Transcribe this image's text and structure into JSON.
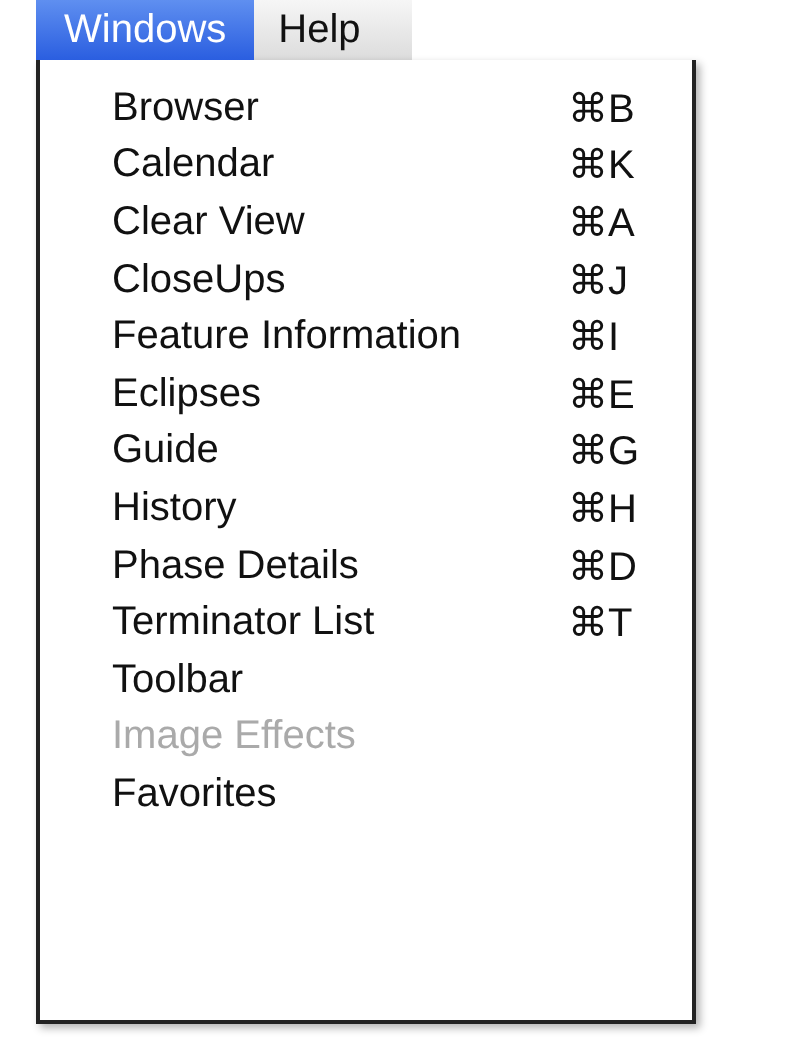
{
  "menu_bar": [
    {
      "label": "Windows",
      "selected": true
    },
    {
      "label": "Help",
      "selected": false
    }
  ],
  "menu": {
    "items": [
      {
        "label": "Browser",
        "shortcut": "⌘B",
        "disabled": false
      },
      {
        "label": "Calendar",
        "shortcut": "⌘K",
        "disabled": false
      },
      {
        "label": "Clear View",
        "shortcut": "⌘A",
        "disabled": false
      },
      {
        "label": "CloseUps",
        "shortcut": "⌘J",
        "disabled": false
      },
      {
        "label": "Feature Information",
        "shortcut": "⌘I",
        "disabled": false
      },
      {
        "label": "Eclipses",
        "shortcut": "⌘E",
        "disabled": false
      },
      {
        "label": "Guide",
        "shortcut": "⌘G",
        "disabled": false
      },
      {
        "label": "History",
        "shortcut": "⌘H",
        "disabled": false
      },
      {
        "label": "Phase Details",
        "shortcut": "⌘D",
        "disabled": false
      },
      {
        "label": "Terminator List",
        "shortcut": "⌘T",
        "disabled": false
      },
      {
        "label": "Toolbar",
        "disabled": false
      },
      {
        "label": "Image Effects",
        "disabled": true
      },
      {
        "label": "Favorites",
        "disabled": false
      }
    ]
  }
}
